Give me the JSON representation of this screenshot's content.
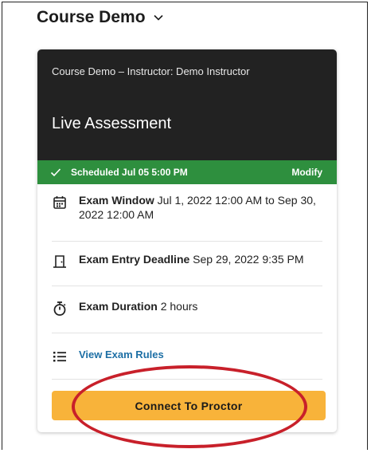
{
  "header": {
    "title": "Course Demo",
    "dropdown_icon": "chevron-down-icon"
  },
  "banner": {
    "course_line": "Course Demo – Instructor: Demo Instructor",
    "assessment_title": "Live Assessment"
  },
  "schedule": {
    "icon": "check-icon",
    "label": "Scheduled Jul 05 5:00 PM",
    "modify_label": "Modify",
    "color": "#2e8f3e"
  },
  "details": {
    "exam_window": {
      "icon": "calendar-icon",
      "label": "Exam Window",
      "value": "Jul 1, 2022 12:00 AM to Sep 30, 2022 12:00 AM"
    },
    "entry_deadline": {
      "icon": "door-icon",
      "label": "Exam Entry Deadline",
      "value": "Sep 29, 2022 9:35 PM"
    },
    "duration": {
      "icon": "stopwatch-icon",
      "label": "Exam Duration",
      "value": "2 hours"
    },
    "rules": {
      "icon": "list-icon",
      "link_label": "View Exam Rules"
    }
  },
  "action": {
    "button_label": "Connect To Proctor",
    "button_color": "#f8b33a"
  },
  "annotation_color": "#c8202a"
}
